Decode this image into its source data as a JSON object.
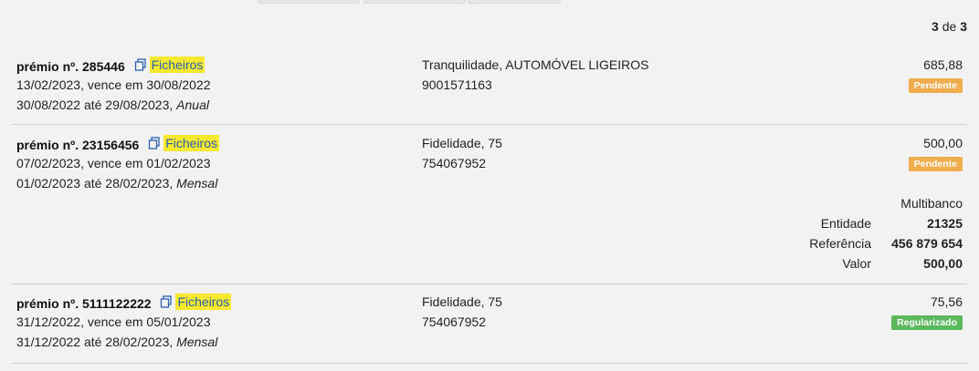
{
  "pager": {
    "current": "3",
    "separator": "de",
    "total": "3"
  },
  "premiums": [
    {
      "title": "prémio nº. 285446",
      "files_label": "Ficheiros",
      "dates": "13/02/2023, vence em 30/08/2022",
      "period": "30/08/2022 até 29/08/2023,",
      "frequency": "Anual",
      "insurer_product": "Tranquilidade, AUTOMÓVEL LIGEIROS",
      "policy_number": "9001571163",
      "amount": "685,88",
      "status": "Pendente",
      "status_color": "#f0ad4e"
    },
    {
      "title": "prémio nº. 23156456",
      "files_label": "Ficheiros",
      "dates": "07/02/2023, vence em 01/02/2023",
      "period": "01/02/2023 até 28/02/2023,",
      "frequency": "Mensal",
      "insurer_product": "Fidelidade, 75",
      "policy_number": "754067952",
      "amount": "500,00",
      "status": "Pendente",
      "status_color": "#f0ad4e",
      "payment": {
        "method": "Multibanco",
        "entity_label": "Entidade",
        "entity_value": "21325",
        "reference_label": "Referência",
        "reference_value": "456 879 654",
        "amount_label": "Valor",
        "amount_value": "500,00"
      }
    },
    {
      "title": "prémio nº. 5111122222",
      "files_label": "Ficheiros",
      "dates": "31/12/2022, vence em 05/01/2023",
      "period": "31/12/2022 até 28/02/2023,",
      "frequency": "Mensal",
      "insurer_product": "Fidelidade, 75",
      "policy_number": "754067952",
      "amount": "75,56",
      "status": "Regularizado",
      "status_color": "#5cb85c"
    }
  ],
  "icons": {
    "files": "copy-icon"
  },
  "colors": {
    "files_highlight": "#f7ea2e",
    "pending": "#f0ad4e",
    "settled": "#5cb85c"
  }
}
